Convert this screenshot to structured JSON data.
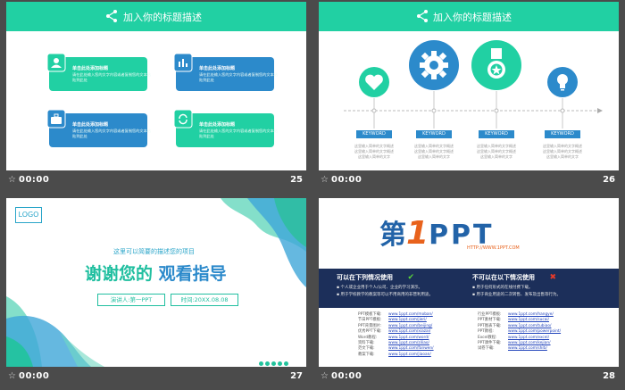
{
  "slides": [
    {
      "time": "00:00",
      "number": "25",
      "header": "加入你的标题描述",
      "cards": [
        {
          "title": "单击此处添加标题",
          "text": "请在此处输入您的文字内容或者复制您的文本粘贴到此处",
          "icon": "user-icon"
        },
        {
          "title": "单击此处添加标题",
          "text": "请在此处输入您的文字内容或者复制您的文本粘贴到此处",
          "icon": "chart-icon"
        },
        {
          "title": "单击此处添加标题",
          "text": "请在此处输入您的文字内容或者复制您的文本粘贴到此处",
          "icon": "briefcase-icon"
        },
        {
          "title": "单击此处添加标题",
          "text": "请在此处输入您的文字内容或者复制您的文本粘贴到此处",
          "icon": "refresh-icon"
        }
      ]
    },
    {
      "time": "00:00",
      "number": "26",
      "header": "加入你的标题描述",
      "items": [
        {
          "keyword": "KEYWORD",
          "text": "这里输入简单的文字概述这里输入简单的文字概述这里输入简单的文字",
          "icon": "heart-icon"
        },
        {
          "keyword": "KEYWORD",
          "text": "这里输入简单的文字概述这里输入简单的文字概述这里输入简单的文字",
          "icon": "gear-icon"
        },
        {
          "keyword": "KEYWORD",
          "text": "这里输入简单的文字概述这里输入简单的文字概述这里输入简单的文字",
          "icon": "medal-icon"
        },
        {
          "keyword": "KEYWORD",
          "text": "这里输入简单的文字概述这里输入简单的文字概述这里输入简单的文字",
          "icon": "bulb-icon"
        }
      ]
    },
    {
      "time": "00:00",
      "number": "27",
      "logo": "LOGO",
      "subtitle": "这里可以简要的描述您的项目",
      "title_a": "谢谢您的",
      "title_b": "观看指导",
      "presenter": "演讲人:第一PPT",
      "date": "时间:20XX.08.08"
    },
    {
      "time": "00:00",
      "number": "28",
      "brand_a": "第",
      "brand_1": "1",
      "brand_b": "PPT",
      "brand_url": "HTTP://WWW.1PPT.COM",
      "can_title": "可以在下列情况使用",
      "cannot_title": "不可以在以下情况使用",
      "can_lines": [
        "▪ 个人或企业用于个人/公司、企业的学习演示。",
        "▪ 用于学校教学的教案等可以不用商用的非营利用途。"
      ],
      "cannot_lines": [
        "▪ 用于任何形式的在线付费下载。",
        "▪ 用于商业用途的二次转售、发布及出售等行为。"
      ],
      "links_left": [
        {
          "label": "PPT模板下载:",
          "url": "www.1ppt.com/moban/"
        },
        {
          "label": "节日PPT模板:",
          "url": "www.1ppt.com/jieri/"
        },
        {
          "label": "PPT背景图片:",
          "url": "www.1ppt.com/beijing/"
        },
        {
          "label": "优秀PPT下载:",
          "url": "www.1ppt.com/xiazai/"
        },
        {
          "label": "Word教程:",
          "url": "www.1ppt.com/word/"
        },
        {
          "label": "资料下载:",
          "url": "www.1ppt.com/ziliao/"
        },
        {
          "label": "范文下载:",
          "url": "www.1ppt.com/fanwen/"
        },
        {
          "label": "教案下载:",
          "url": "www.1ppt.com/jiaoan/"
        }
      ],
      "links_right": [
        {
          "label": "行业PPT模板:",
          "url": "www.1ppt.com/hangye/"
        },
        {
          "label": "PPT素材下载:",
          "url": "www.1ppt.com/sucai/"
        },
        {
          "label": "PPT图表下载:",
          "url": "www.1ppt.com/tubiao/"
        },
        {
          "label": "PPT教程:",
          "url": "www.1ppt.com/powerpoint/"
        },
        {
          "label": "Excel教程:",
          "url": "www.1ppt.com/excel/"
        },
        {
          "label": "PPT课件下载:",
          "url": "www.1ppt.com/kejian/"
        },
        {
          "label": "试卷下载:",
          "url": "www.1ppt.com/shiti/"
        }
      ]
    }
  ]
}
